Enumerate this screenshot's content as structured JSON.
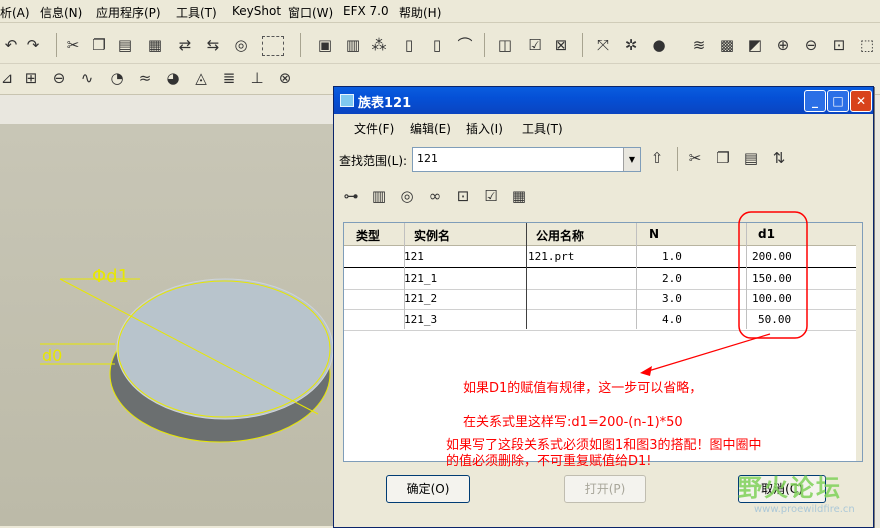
{
  "menubar": [
    "析(A)",
    "信息(N)",
    "应用程序(P)",
    "工具(T)",
    "KeyShot",
    "窗口(W)",
    "EFX 7.0",
    "帮助(H)"
  ],
  "toolbar_icons": [
    "undo-icon",
    "redo-icon",
    "cut-icon",
    "copy-icon",
    "paste-icon",
    "paste-special-icon",
    "regenerate-icon",
    "regen-manager-icon",
    "binoculars-icon",
    "select-box-icon"
  ],
  "dialog": {
    "title": "族表121",
    "menu": [
      "文件(F)",
      "编辑(E)",
      "插入(I)",
      "工具(T)"
    ],
    "find_label": "查找范围(L):",
    "find_value": "121",
    "columns": [
      "类型",
      "实例名",
      "公用名称",
      "N",
      "d1"
    ],
    "rows": [
      {
        "type": "",
        "name": "121",
        "common": "121.prt",
        "n": "1.0",
        "d1": "200.00"
      },
      {
        "type": "",
        "name": "121_1",
        "common": "",
        "n": "2.0",
        "d1": "150.00"
      },
      {
        "type": "",
        "name": "121_2",
        "common": "",
        "n": "3.0",
        "d1": "100.00"
      },
      {
        "type": "",
        "name": "121_3",
        "common": "",
        "n": "4.0",
        "d1": "50.00"
      }
    ],
    "ok_label": "确定(O)",
    "open_label": "打开(P)",
    "cancel_label": "取消(C)"
  },
  "dims": {
    "d1": "Φd1",
    "d0": "d0"
  },
  "notes": {
    "line1": "如果D1的赋值有规律，这一步可以省略，",
    "line2": "在关系式里这样写:d1=200-(n-1)*50",
    "line3": "如果写了这段关系式必须如图1和图3的搭配！图中圈中",
    "line4": "的值必须删除，不可重复赋值给D1!"
  },
  "watermark": {
    "text": "野火论坛",
    "url": "www.proewildfire.cn"
  },
  "colors": {
    "annotation": "#ff0000",
    "title_bar": "#0a5ddf"
  }
}
